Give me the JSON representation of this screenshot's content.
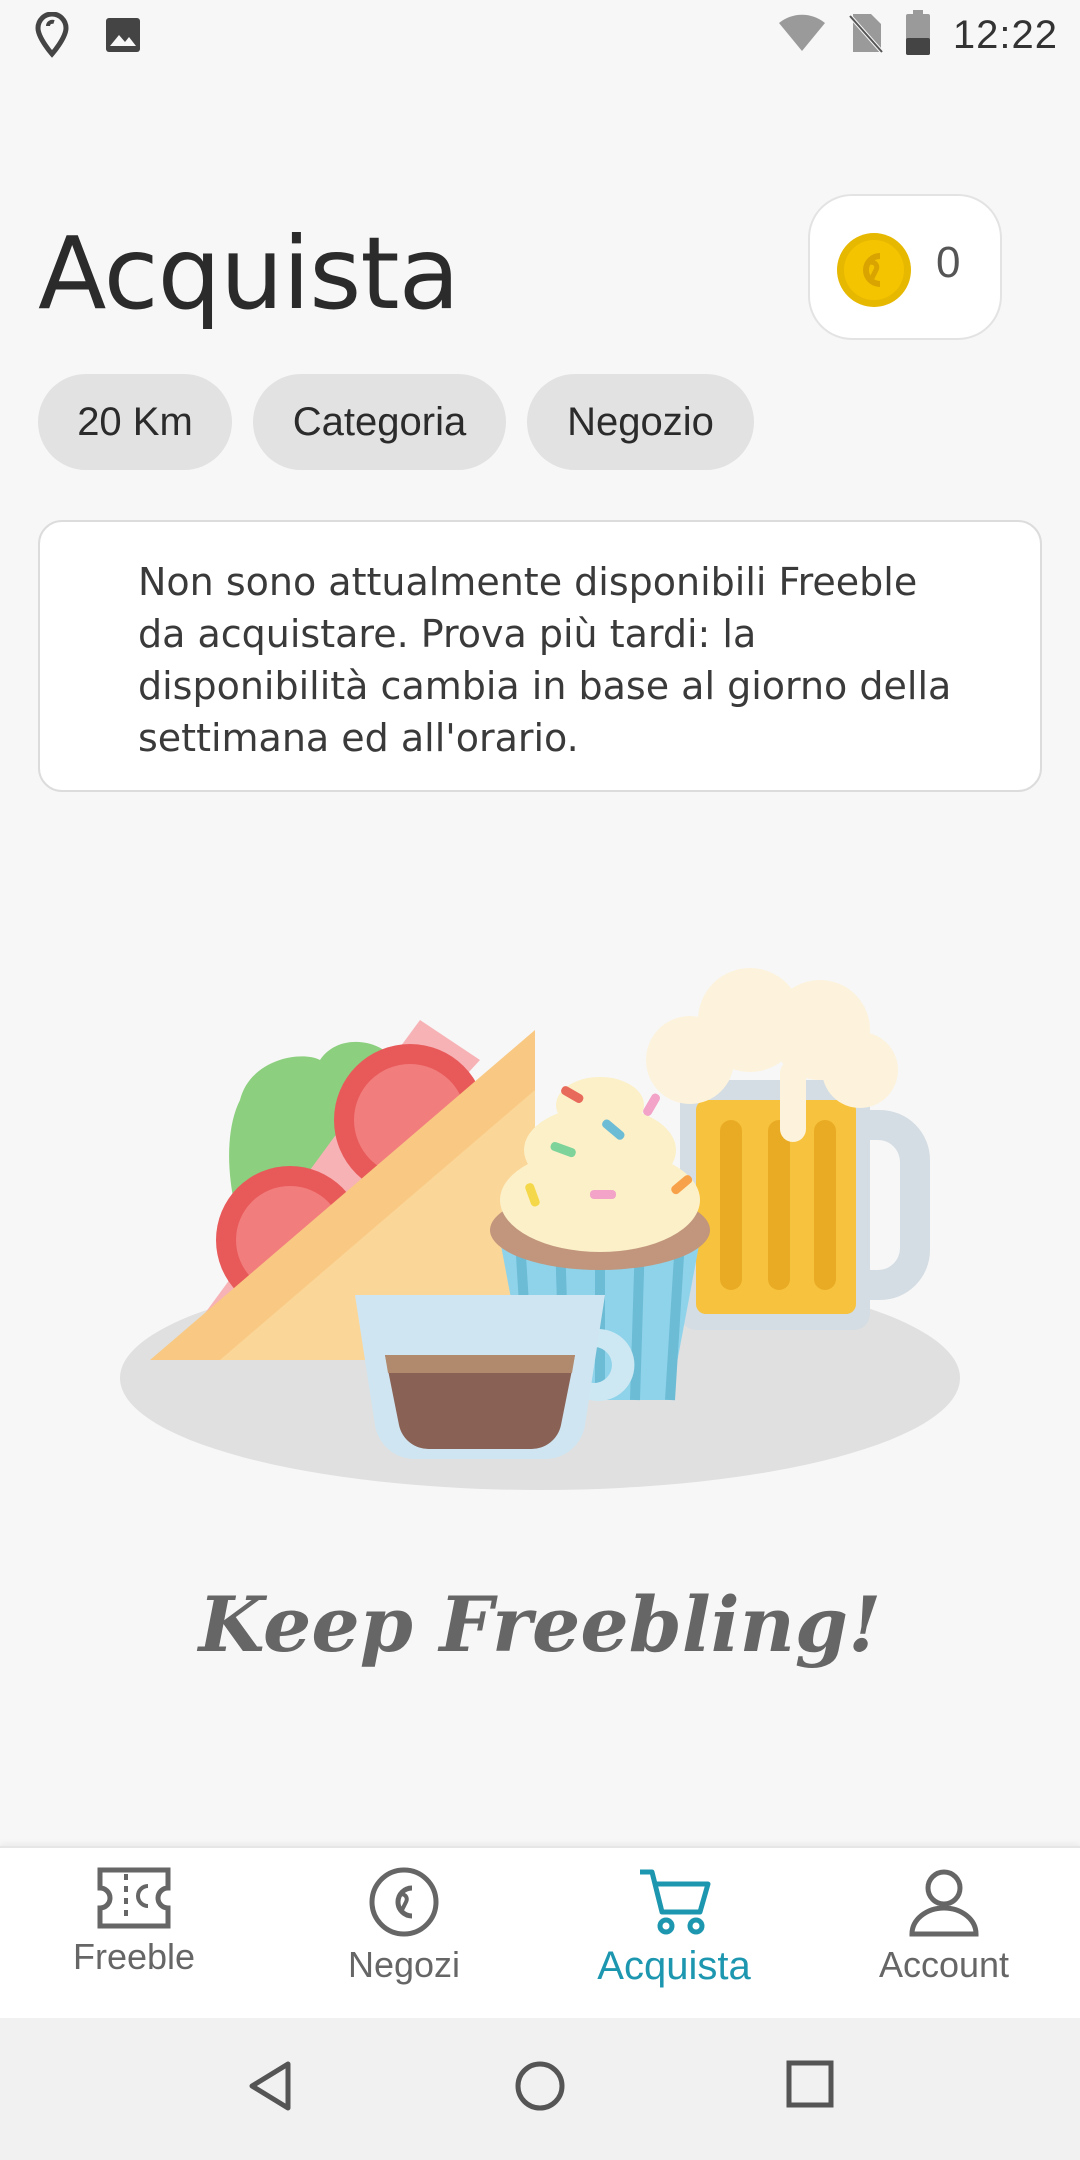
{
  "status_bar": {
    "time": "12:22",
    "icons": [
      "location-pin-icon",
      "image-icon",
      "wifi-icon",
      "no-sim-icon",
      "battery-icon"
    ]
  },
  "header": {
    "title": "Acquista",
    "coin_count": "0",
    "coin_icon": "coin-icon"
  },
  "filters": [
    {
      "label": "20 Km"
    },
    {
      "label": "Categoria"
    },
    {
      "label": "Negozio"
    }
  ],
  "message": "Non sono attualmente disponibili Freeble da acquistare. Prova più tardi: la disponibilità cambia in base al giorno della settimana ed all'orario.",
  "illustration": "food-illustration",
  "slogan": "Keep Freebling!",
  "bottom_nav": {
    "items": [
      {
        "label": "Freeble",
        "icon": "ticket-icon",
        "active": false
      },
      {
        "label": "Negozi",
        "icon": "store-coin-icon",
        "active": false
      },
      {
        "label": "Acquista",
        "icon": "cart-icon",
        "active": true
      },
      {
        "label": "Account",
        "icon": "person-icon",
        "active": false
      }
    ]
  },
  "colors": {
    "accent": "#1d97b0",
    "coin": "#f5c400",
    "background": "#f7f7f7"
  }
}
